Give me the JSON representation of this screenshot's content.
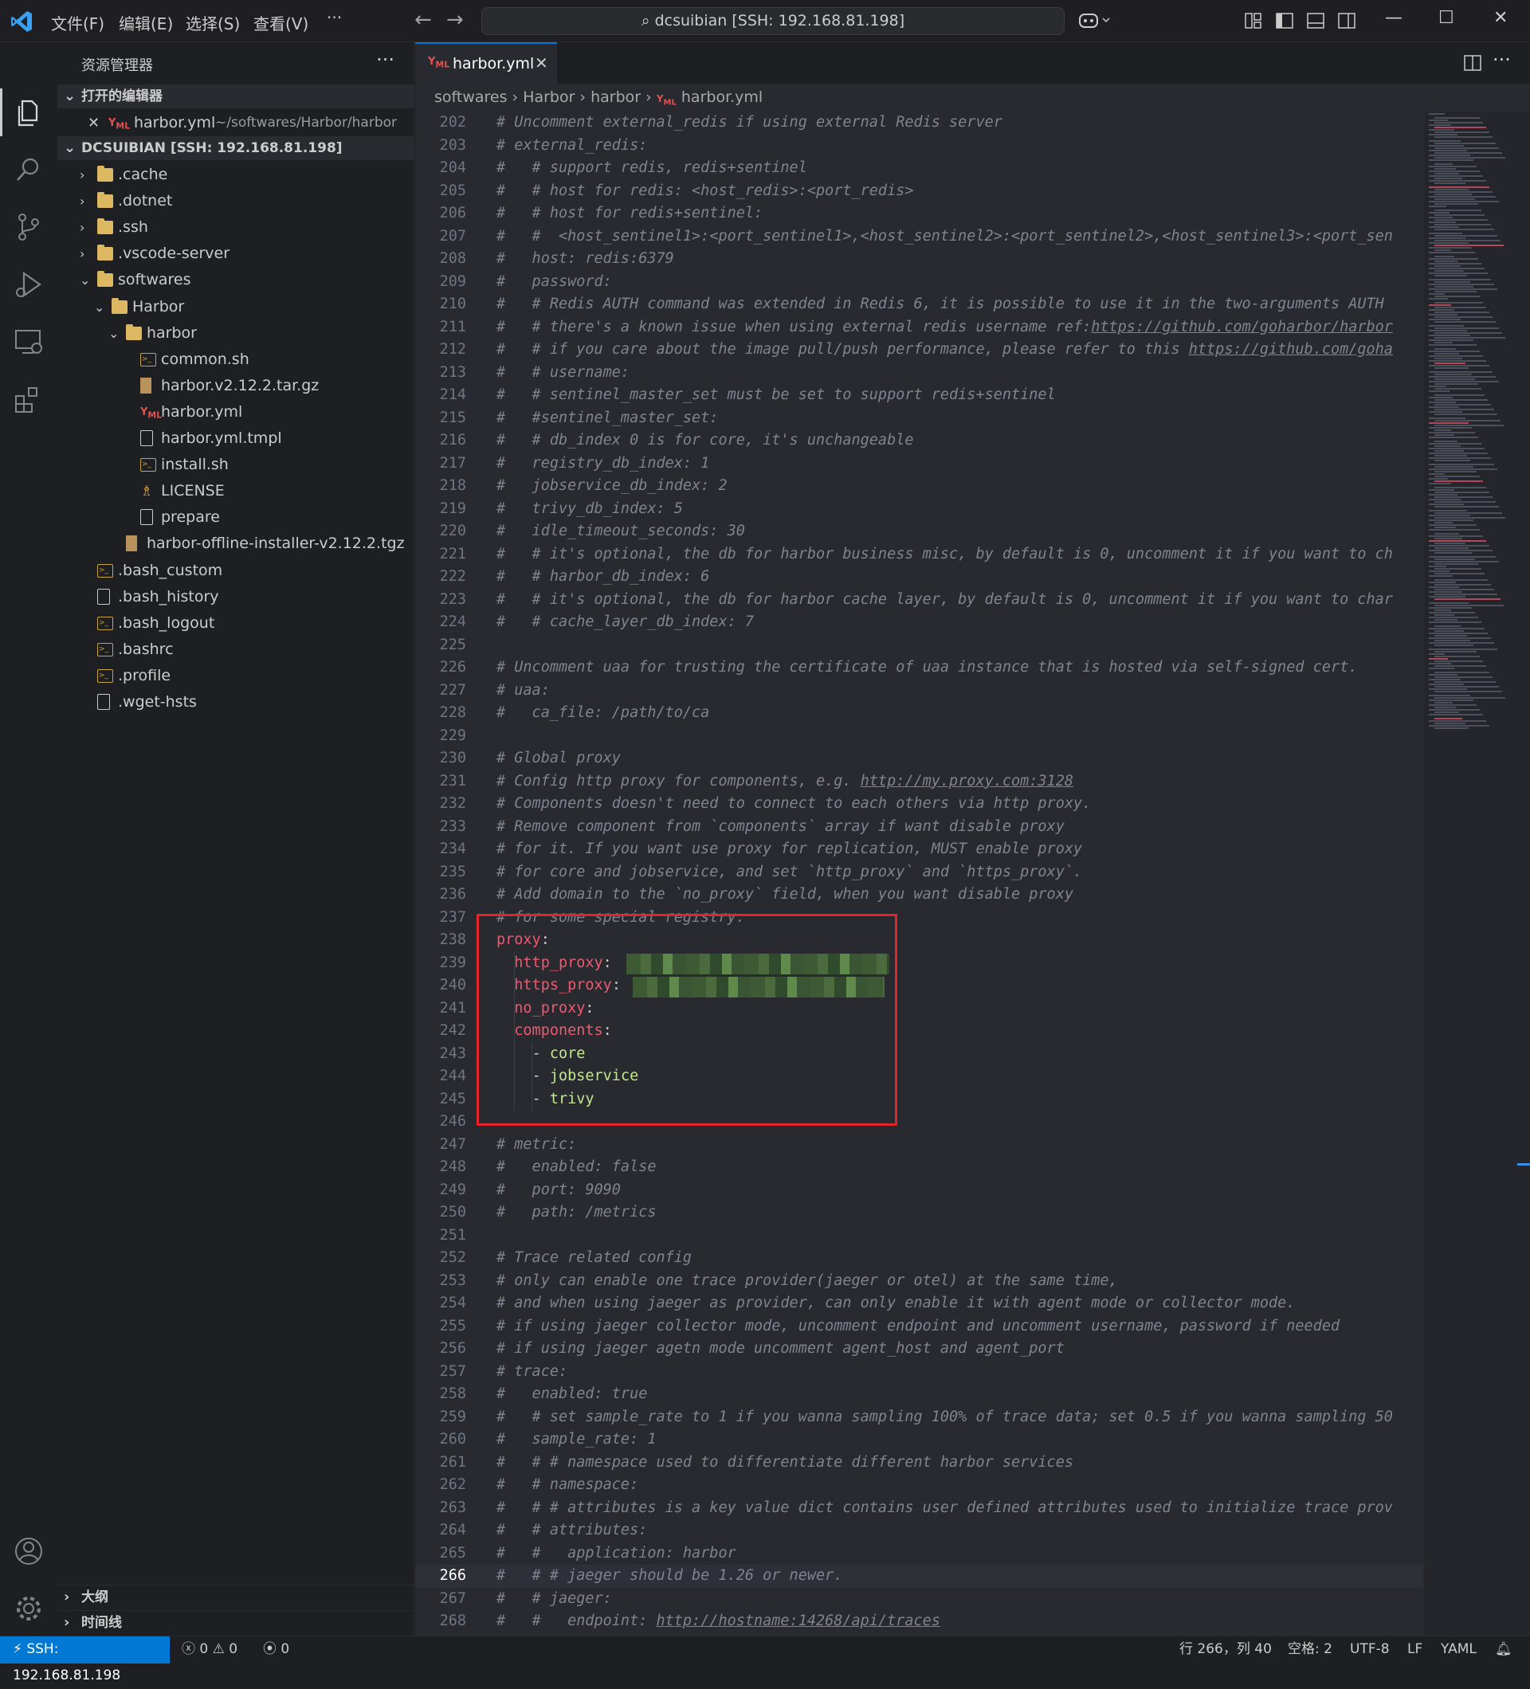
{
  "titlebar": {
    "menus": [
      "文件(F)",
      "编辑(E)",
      "选择(S)",
      "查看(V)"
    ],
    "more": "···",
    "search_text": "dcsuibian [SSH: 192.168.81.198]",
    "copilot": "copilot-icon"
  },
  "sidebar": {
    "title": "资源管理器",
    "more": "···",
    "open_editors_header": "打开的编辑器",
    "open_editor": {
      "name": "harbor.yml",
      "path": "~/softwares/Harbor/harbor"
    },
    "workspace_header": "DCSUIBIAN [SSH: 192.168.81.198]",
    "tree": [
      {
        "label": ".cache",
        "kind": "folder",
        "depth": 0,
        "expanded": false
      },
      {
        "label": ".dotnet",
        "kind": "folder",
        "depth": 0,
        "expanded": false
      },
      {
        "label": ".ssh",
        "kind": "folder",
        "depth": 0,
        "expanded": false
      },
      {
        "label": ".vscode-server",
        "kind": "folder",
        "depth": 0,
        "expanded": false
      },
      {
        "label": "softwares",
        "kind": "folder",
        "depth": 0,
        "expanded": true
      },
      {
        "label": "Harbor",
        "kind": "folder",
        "depth": 1,
        "expanded": true
      },
      {
        "label": "harbor",
        "kind": "folder",
        "depth": 2,
        "expanded": true
      },
      {
        "label": "common.sh",
        "kind": "sh",
        "depth": 3
      },
      {
        "label": "harbor.v2.12.2.tar.gz",
        "kind": "zip",
        "depth": 3
      },
      {
        "label": "harbor.yml",
        "kind": "yml",
        "depth": 3
      },
      {
        "label": "harbor.yml.tmpl",
        "kind": "file",
        "depth": 3
      },
      {
        "label": "install.sh",
        "kind": "sh",
        "depth": 3
      },
      {
        "label": "LICENSE",
        "kind": "license",
        "depth": 3
      },
      {
        "label": "prepare",
        "kind": "file",
        "depth": 3
      },
      {
        "label": "harbor-offline-installer-v2.12.2.tgz",
        "kind": "zip",
        "depth": 2
      },
      {
        "label": ".bash_custom",
        "kind": "sh",
        "depth": 0
      },
      {
        "label": ".bash_history",
        "kind": "file",
        "depth": 0
      },
      {
        "label": ".bash_logout",
        "kind": "sh",
        "depth": 0
      },
      {
        "label": ".bashrc",
        "kind": "sh",
        "depth": 0
      },
      {
        "label": ".profile",
        "kind": "sh",
        "depth": 0
      },
      {
        "label": ".wget-hsts",
        "kind": "file",
        "depth": 0
      }
    ],
    "outline_header": "大纲",
    "timeline_header": "时间线"
  },
  "editor": {
    "tab_label": "harbor.yml",
    "breadcrumb": [
      "softwares",
      "Harbor",
      "harbor",
      "harbor.yml"
    ],
    "current_line": 266,
    "lines": [
      {
        "n": 202,
        "t": "# Uncomment external_redis if using external Redis server"
      },
      {
        "n": 203,
        "t": "# external_redis:"
      },
      {
        "n": 204,
        "t": "#   # support redis, redis+sentinel"
      },
      {
        "n": 205,
        "t": "#   # host for redis: <host_redis>:<port_redis>"
      },
      {
        "n": 206,
        "t": "#   # host for redis+sentinel:"
      },
      {
        "n": 207,
        "t": "#   #  <host_sentinel1>:<port_sentinel1>,<host_sentinel2>:<port_sentinel2>,<host_sentinel3>:<port_sen"
      },
      {
        "n": 208,
        "t": "#   host: redis:6379"
      },
      {
        "n": 209,
        "t": "#   password:"
      },
      {
        "n": 210,
        "t": "#   # Redis AUTH command was extended in Redis 6, it is possible to use it in the two-arguments AUTH"
      },
      {
        "n": 211,
        "t": "#   # there's a known issue when using external redis username ref:https://github.com/goharbor/harbor"
      },
      {
        "n": 212,
        "t": "#   # if you care about the image pull/push performance, please refer to this https://github.com/goha"
      },
      {
        "n": 213,
        "t": "#   # username:"
      },
      {
        "n": 214,
        "t": "#   # sentinel_master_set must be set to support redis+sentinel"
      },
      {
        "n": 215,
        "t": "#   #sentinel_master_set:"
      },
      {
        "n": 216,
        "t": "#   # db_index 0 is for core, it's unchangeable"
      },
      {
        "n": 217,
        "t": "#   registry_db_index: 1"
      },
      {
        "n": 218,
        "t": "#   jobservice_db_index: 2"
      },
      {
        "n": 219,
        "t": "#   trivy_db_index: 5"
      },
      {
        "n": 220,
        "t": "#   idle_timeout_seconds: 30"
      },
      {
        "n": 221,
        "t": "#   # it's optional, the db for harbor business misc, by default is 0, uncomment it if you want to ch"
      },
      {
        "n": 222,
        "t": "#   # harbor_db_index: 6"
      },
      {
        "n": 223,
        "t": "#   # it's optional, the db for harbor cache layer, by default is 0, uncomment it if you want to char"
      },
      {
        "n": 224,
        "t": "#   # cache_layer_db_index: 7"
      },
      {
        "n": 225,
        "t": ""
      },
      {
        "n": 226,
        "t": "# Uncomment uaa for trusting the certificate of uaa instance that is hosted via self-signed cert."
      },
      {
        "n": 227,
        "t": "# uaa:"
      },
      {
        "n": 228,
        "t": "#   ca_file: /path/to/ca"
      },
      {
        "n": 229,
        "t": ""
      },
      {
        "n": 230,
        "t": "# Global proxy"
      },
      {
        "n": 231,
        "t": "# Config http proxy for components, e.g. http://my.proxy.com:3128"
      },
      {
        "n": 232,
        "t": "# Components doesn't need to connect to each others via http proxy."
      },
      {
        "n": 233,
        "t": "# Remove component from `components` array if want disable proxy"
      },
      {
        "n": 234,
        "t": "# for it. If you want use proxy for replication, MUST enable proxy"
      },
      {
        "n": 235,
        "t": "# for core and jobservice, and set `http_proxy` and `https_proxy`."
      },
      {
        "n": 236,
        "t": "# Add domain to the `no_proxy` field, when you want disable proxy"
      },
      {
        "n": 237,
        "t": "# for some special registry."
      },
      {
        "n": 238,
        "t": "proxy:"
      },
      {
        "n": 239,
        "t": "  http_proxy:"
      },
      {
        "n": 240,
        "t": "  https_proxy:"
      },
      {
        "n": 241,
        "t": "  no_proxy:"
      },
      {
        "n": 242,
        "t": "  components:"
      },
      {
        "n": 243,
        "t": "    - core"
      },
      {
        "n": 244,
        "t": "    - jobservice"
      },
      {
        "n": 245,
        "t": "    - trivy"
      },
      {
        "n": 246,
        "t": ""
      },
      {
        "n": 247,
        "t": "# metric:"
      },
      {
        "n": 248,
        "t": "#   enabled: false"
      },
      {
        "n": 249,
        "t": "#   port: 9090"
      },
      {
        "n": 250,
        "t": "#   path: /metrics"
      },
      {
        "n": 251,
        "t": ""
      },
      {
        "n": 252,
        "t": "# Trace related config"
      },
      {
        "n": 253,
        "t": "# only can enable one trace provider(jaeger or otel) at the same time,"
      },
      {
        "n": 254,
        "t": "# and when using jaeger as provider, can only enable it with agent mode or collector mode."
      },
      {
        "n": 255,
        "t": "# if using jaeger collector mode, uncomment endpoint and uncomment username, password if needed"
      },
      {
        "n": 256,
        "t": "# if using jaeger agetn mode uncomment agent_host and agent_port"
      },
      {
        "n": 257,
        "t": "# trace:"
      },
      {
        "n": 258,
        "t": "#   enabled: true"
      },
      {
        "n": 259,
        "t": "#   # set sample_rate to 1 if you wanna sampling 100% of trace data; set 0.5 if you wanna sampling 50"
      },
      {
        "n": 260,
        "t": "#   sample_rate: 1"
      },
      {
        "n": 261,
        "t": "#   # # namespace used to differentiate different harbor services"
      },
      {
        "n": 262,
        "t": "#   # namespace:"
      },
      {
        "n": 263,
        "t": "#   # # attributes is a key value dict contains user defined attributes used to initialize trace prov"
      },
      {
        "n": 264,
        "t": "#   # attributes:"
      },
      {
        "n": 265,
        "t": "#   #   application: harbor"
      },
      {
        "n": 266,
        "t": "#   # # jaeger should be 1.26 or newer."
      },
      {
        "n": 267,
        "t": "#   # jaeger:"
      },
      {
        "n": 268,
        "t": "#   #   endpoint: http://hostname:14268/api/traces"
      }
    ]
  },
  "statusbar": {
    "remote": "SSH: 192.168.81.198",
    "errors": "0",
    "warnings": "0",
    "ports": "0",
    "position": "行 266，列 40",
    "spaces": "空格: 2",
    "encoding": "UTF-8",
    "eol": "LF",
    "language": "YAML"
  },
  "colors": {
    "accent": "#0078d4",
    "highlight_box": "#e0262b",
    "yaml_key": "#ef596f",
    "yaml_string": "#c3e88d",
    "comment": "#7f848e"
  }
}
